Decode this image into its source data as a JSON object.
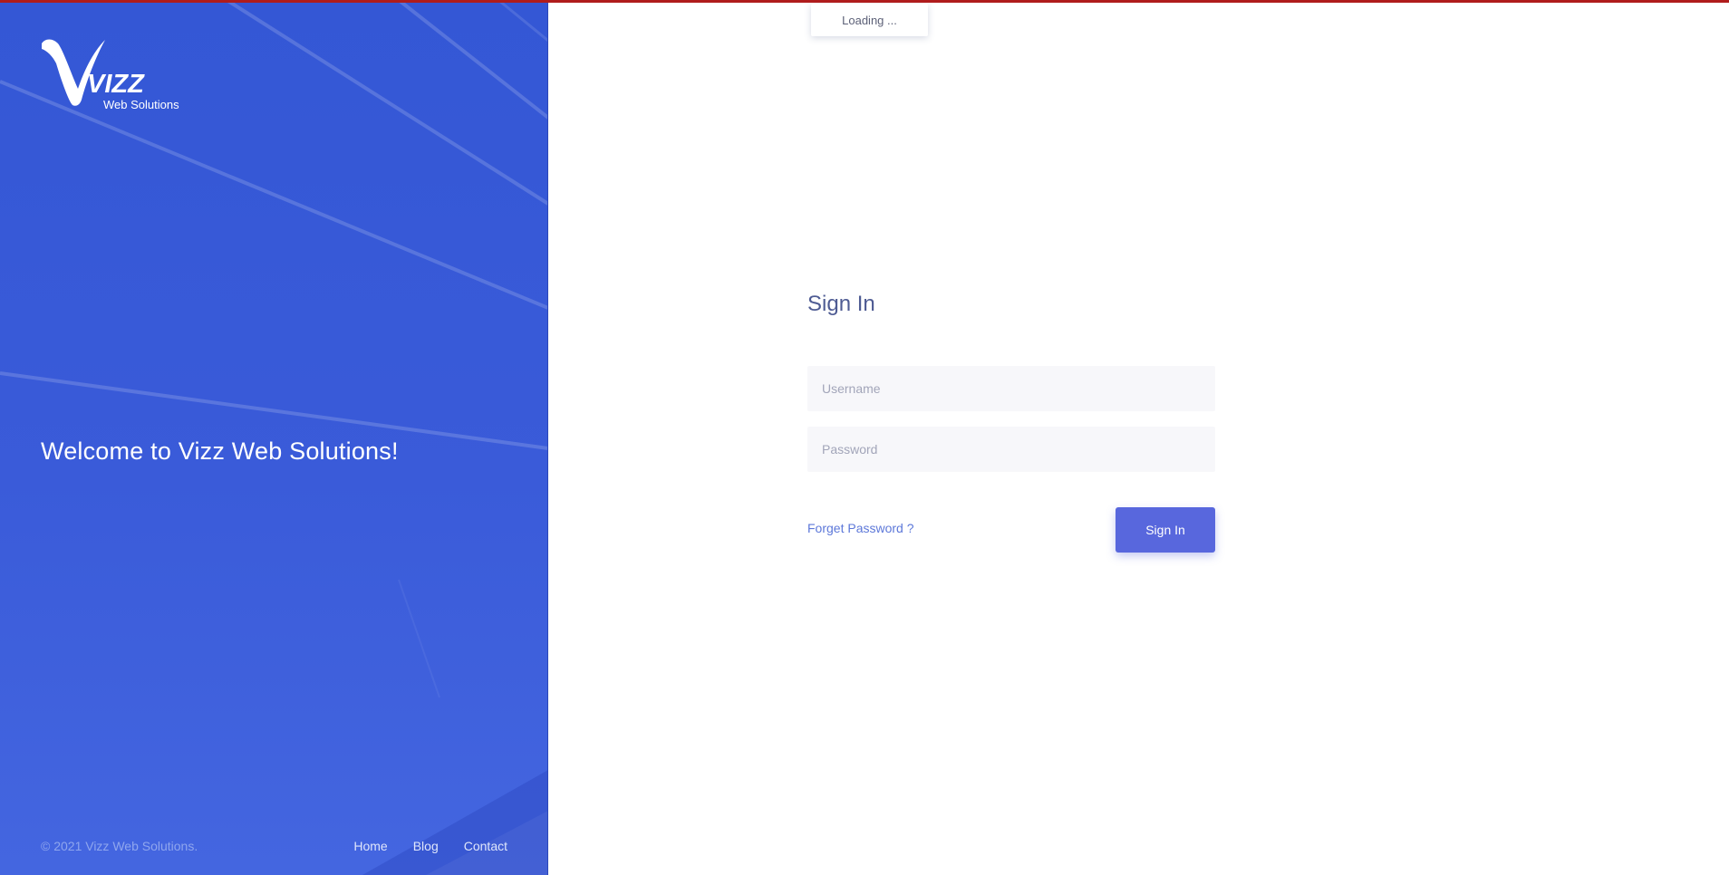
{
  "aside": {
    "logo_text": "VIZZ",
    "logo_subtext": "Web Solutions",
    "welcome": "Welcome to Vizz Web Solutions!",
    "copyright": "© 2021 Vizz Web Solutions.",
    "links": [
      "Home",
      "Blog",
      "Contact"
    ]
  },
  "loading": {
    "text": "Loading ..."
  },
  "form": {
    "title": "Sign In",
    "username_placeholder": "Username",
    "username_value": "",
    "password_placeholder": "Password",
    "password_value": "",
    "forget_label": "Forget Password ?",
    "submit_label": "Sign In"
  },
  "colors": {
    "aside_bg": "#3457d5",
    "accent": "#5867dd",
    "title": "#4e5b93",
    "link": "#5d78d9",
    "top_bar": "#b01c1c"
  }
}
